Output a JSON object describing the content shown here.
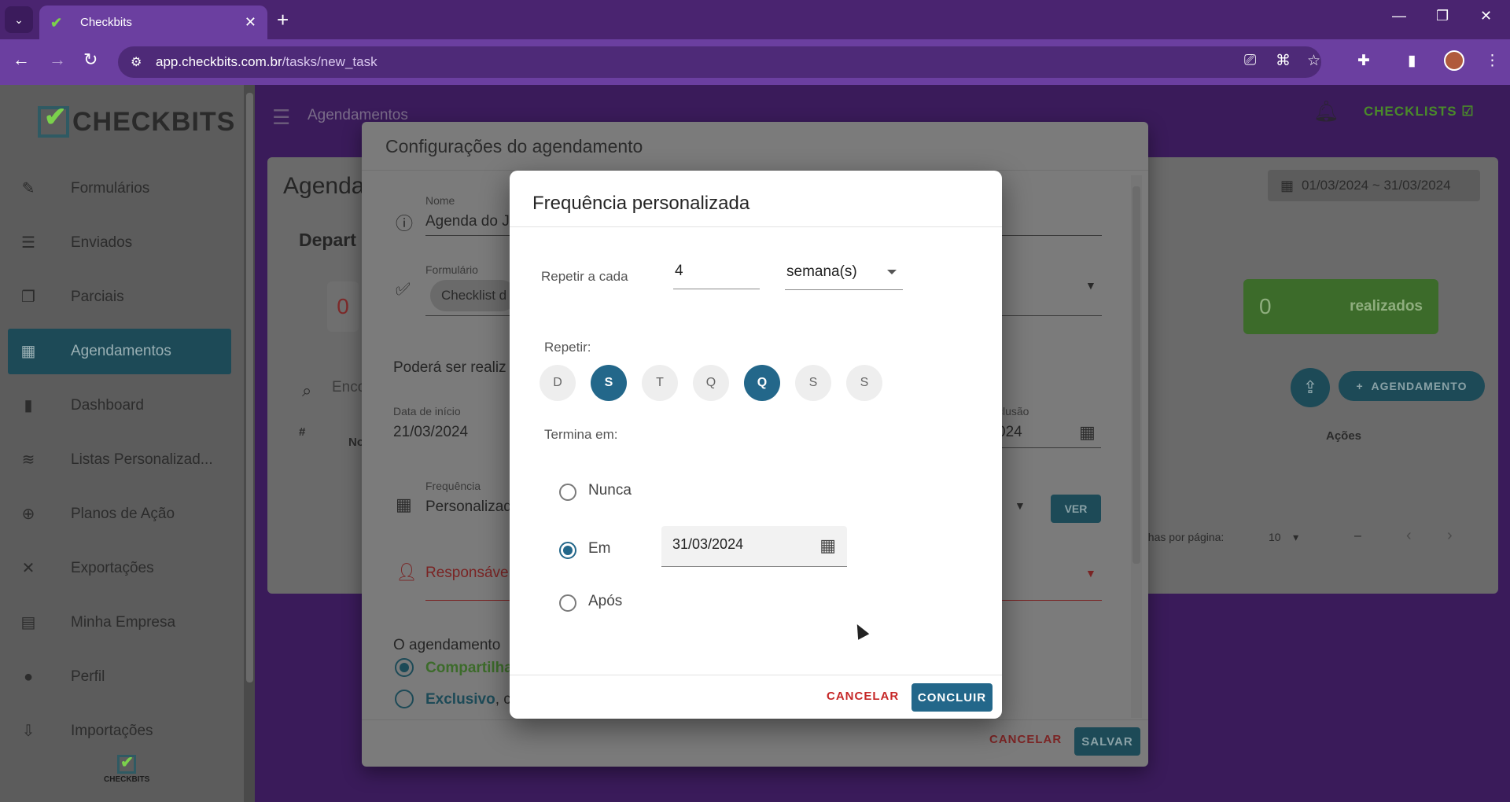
{
  "browser": {
    "tab_title": "Checkbits",
    "url_domain": "app.checkbits.com.br",
    "url_path": "/tasks/new_task"
  },
  "sidebar": {
    "logo": "CHECKBITS",
    "items": [
      {
        "label": "Formulários",
        "icon": "forms-icon"
      },
      {
        "label": "Enviados",
        "icon": "sent-icon"
      },
      {
        "label": "Parciais",
        "icon": "partial-icon"
      },
      {
        "label": "Agendamentos",
        "icon": "calendar-check-icon",
        "active": true
      },
      {
        "label": "Dashboard",
        "icon": "bar-chart-icon"
      },
      {
        "label": "Listas Personalizad...",
        "icon": "database-icon"
      },
      {
        "label": "Planos de Ação",
        "icon": "target-icon"
      },
      {
        "label": "Exportações",
        "icon": "excel-icon"
      },
      {
        "label": "Minha Empresa",
        "icon": "building-icon"
      },
      {
        "label": "Perfil",
        "icon": "person-icon"
      },
      {
        "label": "Importações",
        "icon": "import-icon"
      }
    ],
    "footer_logo": "CHECKBITS"
  },
  "topbar": {
    "title": "Agendamentos",
    "checklists_label": "CHECKLISTS"
  },
  "page": {
    "title": "Agenda",
    "subtitle": "Depart",
    "date_range": "01/03/2024 ~ 31/03/2024",
    "stat_red_value": "0",
    "stat_green_value": "0",
    "stat_green_label": "realizados",
    "add_schedule_label": "AGENDAMENTO",
    "search_placeholder": "Enco",
    "col_hash": "#",
    "col_no": "No",
    "col_actions": "Ações",
    "rows_per_page_label": "nhas por página:",
    "rows_per_page_value": "10",
    "pagination_range": "–"
  },
  "config_dialog": {
    "title": "Configurações do agendamento",
    "name_label": "Nome",
    "name_value": "Agenda do J",
    "form_label": "Formulário",
    "form_chip": "Checklist d",
    "can_be_done_text": "Poderá ser realiz",
    "start_label": "Data de início",
    "start_value": "21/03/2024",
    "end_label": "clusão",
    "end_value": "024",
    "frequency_label": "Frequência",
    "frequency_value": "Personalizad",
    "ver_label": "VER",
    "responsible_label": "Responsáve",
    "schedule_text": "O agendamento",
    "shared_label": "Compartilha",
    "exclusive_label": "Exclusivo",
    "exclusive_suffix": ", ca",
    "cancel_label": "CANCELAR",
    "save_label": "SALVAR"
  },
  "freq_dialog": {
    "title": "Frequência personalizada",
    "repeat_every_label": "Repetir a cada",
    "repeat_every_value": "4",
    "repeat_unit": "semana(s)",
    "repeat_label": "Repetir:",
    "days": [
      {
        "letter": "D",
        "selected": false
      },
      {
        "letter": "S",
        "selected": true
      },
      {
        "letter": "T",
        "selected": false
      },
      {
        "letter": "Q",
        "selected": false
      },
      {
        "letter": "Q",
        "selected": true
      },
      {
        "letter": "S",
        "selected": false
      },
      {
        "letter": "S",
        "selected": false
      }
    ],
    "ends_label": "Termina em:",
    "ends_options": [
      {
        "label": "Nunca",
        "selected": false
      },
      {
        "label": "Em",
        "selected": true
      },
      {
        "label": "Após",
        "selected": false
      }
    ],
    "ends_date": "31/03/2024",
    "cancel_label": "CANCELAR",
    "ok_label": "CONCLUIR"
  },
  "colors": {
    "primary": "#23678a",
    "danger": "#c62828",
    "success": "#4caf50",
    "browser_frame": "#6b3fa0"
  }
}
